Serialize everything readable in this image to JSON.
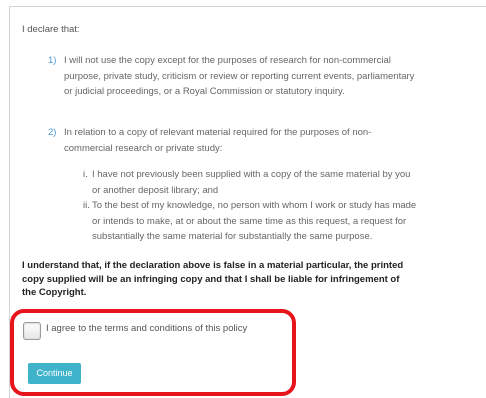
{
  "declaration": {
    "intro": "I declare that:",
    "items": [
      {
        "number": "1)",
        "lines": [
          "I will not use the copy except for the purposes of research for non-commercial",
          "purpose, private study, criticism or review or reporting current events, parliamentary",
          "or judicial proceedings, or a Royal Commission or statutory inquiry."
        ]
      },
      {
        "number": "2)",
        "lines": [
          "In relation to a copy of relevant material required for the purposes of non-",
          "commercial research or private study:"
        ]
      }
    ],
    "subitems": [
      {
        "number": "i.",
        "lines": [
          "I have not previously been supplied with a copy of the same material by you",
          "or another deposit library; and"
        ]
      },
      {
        "number": "ii.",
        "lines": [
          "To the best of my knowledge, no person with whom I work or study has made",
          "or intends to make, at or about the same time as this request, a request for",
          "substantially the same material for substantially the same purpose."
        ]
      }
    ],
    "understanding_lines": [
      "I understand that, if the declaration above is false in a material particular, the printed",
      "copy supplied will be an infringing copy and that I shall be liable for infringement of",
      "the Copyright."
    ]
  },
  "agreement": {
    "checkbox_label": "I agree to the terms and conditions of this policy",
    "checked": false
  },
  "continue_button": {
    "label": "Continue",
    "color": "#3fb3c9"
  },
  "highlight_color": "#e8141c"
}
